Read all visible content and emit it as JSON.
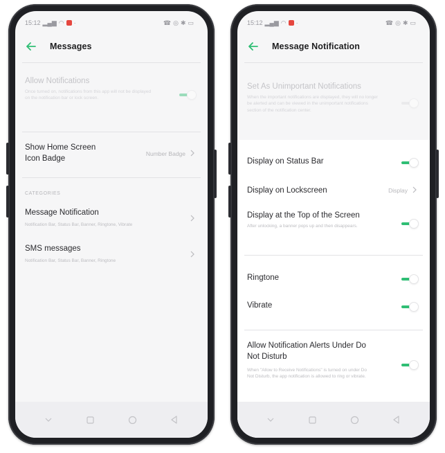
{
  "status_bar": {
    "time": "15:12"
  },
  "left_screen": {
    "title": "Messages",
    "allow_notifications": {
      "title": "Allow Notifications",
      "subtitle": "Once turned on, notifications from this app will not be displayed on the notification bar or lock screen.",
      "enabled": true
    },
    "icon_badge": {
      "title_line1": "Show Home Screen",
      "title_line2": "Icon Badge",
      "value": "Number Badge"
    },
    "categories_header": "CATEGORIES",
    "categories": [
      {
        "title": "Message Notification",
        "subtitle": "Notification Bar, Status Bar, Banner, Ringtone, Vibrate"
      },
      {
        "title": "SMS messages",
        "subtitle": "Notification Bar, Status Bar, Banner, Ringtone"
      }
    ]
  },
  "right_screen": {
    "title": "Message Notification",
    "unimportant": {
      "title": "Set As Unimportant Notifications",
      "subtitle": "When the important notifications are displayed, they will no longer be alerted and can be viewed in the unimportant notifications section of the notification center.",
      "enabled": false
    },
    "status_bar_row": {
      "title": "Display on Status Bar",
      "enabled": true
    },
    "lockscreen_row": {
      "title": "Display on Lockscreen",
      "value": "Display"
    },
    "top_of_screen": {
      "title": "Display at the Top of the Screen",
      "subtitle": "After unlocking, a banner pops up and then disappears.",
      "enabled": true
    },
    "ringtone": {
      "title": "Ringtone",
      "enabled": true
    },
    "vibrate": {
      "title": "Vibrate",
      "enabled": true
    },
    "dnd": {
      "title_line1": "Allow Notification Alerts Under Do",
      "title_line2": "Not Disturb",
      "subtitle": "When \"Allow to Receive Notifications\" is turned on under Do Not Disturb, the app notification is allowed to ring or vibrate.",
      "enabled": true
    }
  },
  "colors": {
    "accent": "#2fbe74",
    "screen_bg": "#f6f6f7",
    "phone_frame": "#1f2024",
    "indicator": "#e5473f"
  }
}
